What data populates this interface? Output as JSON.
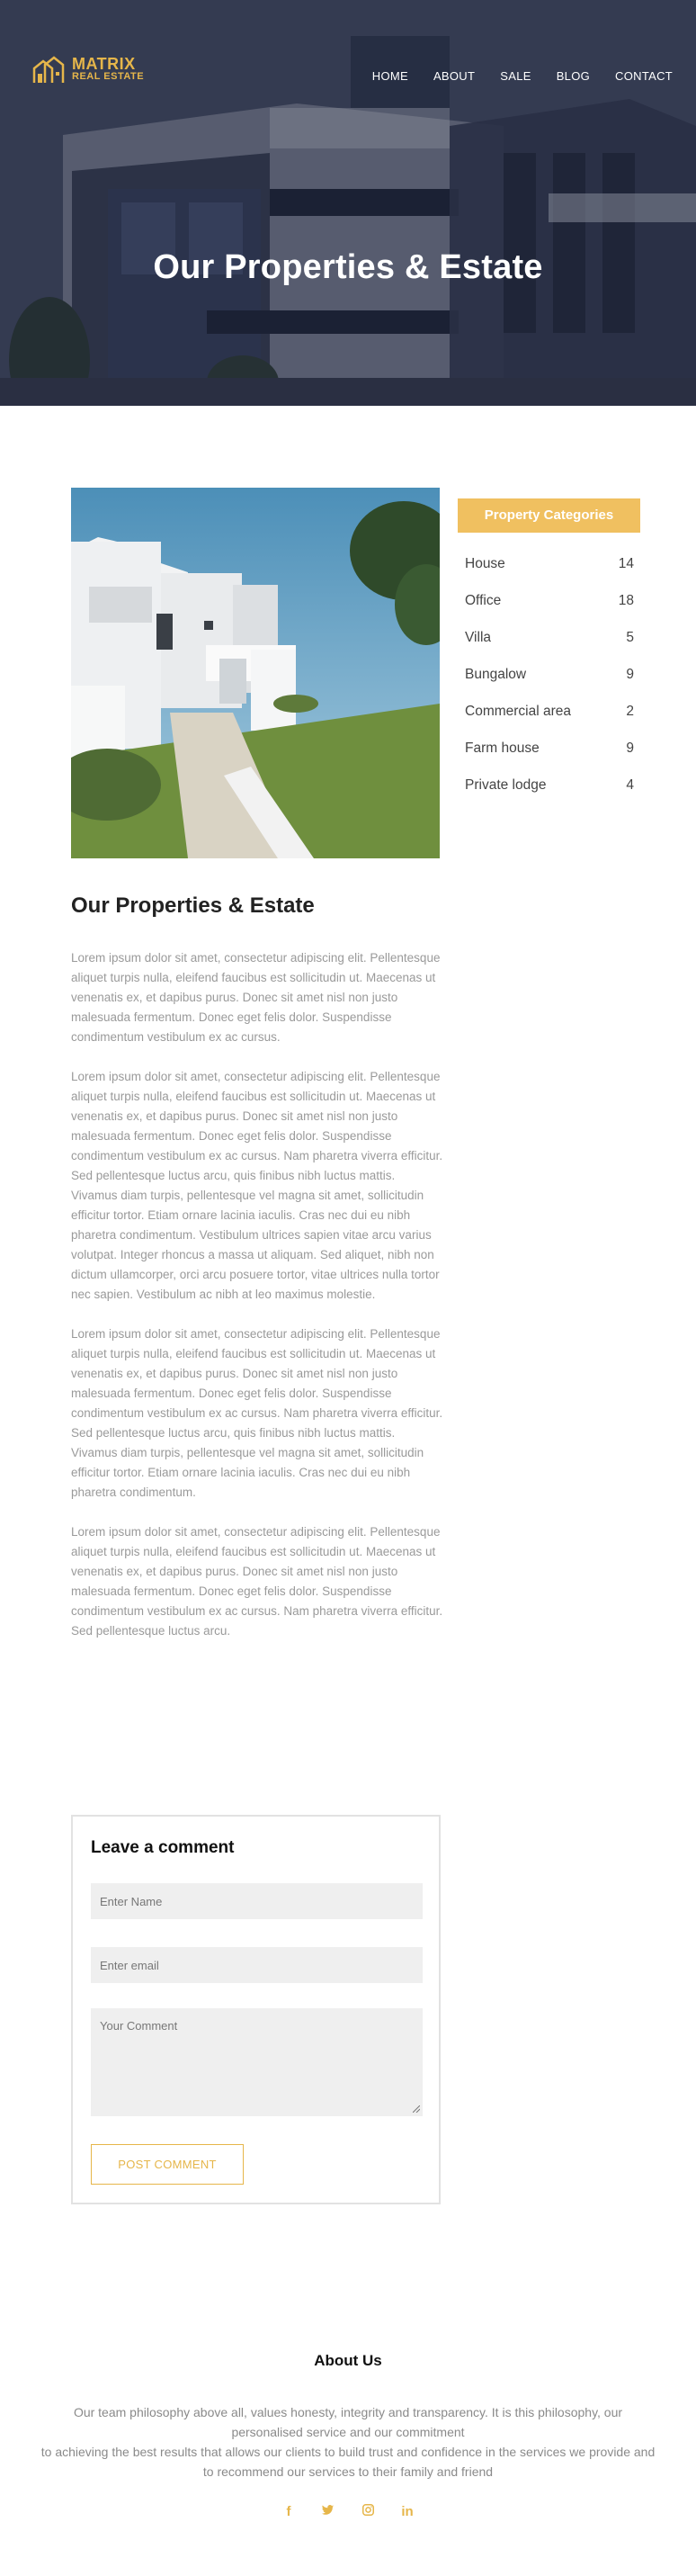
{
  "brand": {
    "name_line1": "MATRIX",
    "name_line2": "REAL ESTATE",
    "color": "#e6b64a"
  },
  "nav": {
    "items": [
      "HOME",
      "ABOUT",
      "SALE",
      "BLOG",
      "CONTACT"
    ]
  },
  "hero": {
    "title": "Our Properties & Estate"
  },
  "article": {
    "title": "Our Properties & Estate",
    "paragraphs": [
      "Lorem ipsum dolor sit amet, consectetur adipiscing elit. Pellentesque aliquet turpis nulla, eleifend faucibus est sollicitudin ut. Maecenas ut venenatis ex, et dapibus purus. Donec sit amet nisl non justo malesuada fermentum. Donec eget felis dolor. Suspendisse condimentum vestibulum ex ac cursus.",
      "Lorem ipsum dolor sit amet, consectetur adipiscing elit. Pellentesque aliquet turpis nulla, eleifend faucibus est sollicitudin ut. Maecenas ut venenatis ex, et dapibus purus. Donec sit amet nisl non justo malesuada fermentum. Donec eget felis dolor. Suspendisse condimentum vestibulum ex ac cursus. Nam pharetra viverra efficitur. Sed pellentesque luctus arcu, quis finibus nibh luctus mattis. Vivamus diam turpis, pellentesque vel magna sit amet, sollicitudin efficitur tortor. Etiam ornare lacinia iaculis. Cras nec dui eu nibh pharetra condimentum. Vestibulum ultrices sapien vitae arcu varius volutpat. Integer rhoncus a massa ut aliquam. Sed aliquet, nibh non dictum ullamcorper, orci arcu posuere tortor, vitae ultrices nulla tortor nec sapien. Vestibulum ac nibh at leo maximus molestie.",
      "Lorem ipsum dolor sit amet, consectetur adipiscing elit. Pellentesque aliquet turpis nulla, eleifend faucibus est sollicitudin ut. Maecenas ut venenatis ex, et dapibus purus. Donec sit amet nisl non justo malesuada fermentum. Donec eget felis dolor. Suspendisse condimentum vestibulum ex ac cursus. Nam pharetra viverra efficitur. Sed pellentesque luctus arcu, quis finibus nibh luctus mattis. Vivamus diam turpis, pellentesque vel magna sit amet, sollicitudin efficitur tortor. Etiam ornare lacinia iaculis. Cras nec dui eu nibh pharetra condimentum.",
      "Lorem ipsum dolor sit amet, consectetur adipiscing elit. Pellentesque aliquet turpis nulla, eleifend faucibus est sollicitudin ut. Maecenas ut venenatis ex, et dapibus purus. Donec sit amet nisl non justo malesuada fermentum. Donec eget felis dolor. Suspendisse condimentum vestibulum ex ac cursus. Nam pharetra viverra efficitur. Sed pellentesque luctus arcu."
    ]
  },
  "sidebar": {
    "heading": "Property Categories",
    "heading_color": "#f0c060",
    "categories": [
      {
        "label": "House",
        "count": "14"
      },
      {
        "label": "Office",
        "count": "18"
      },
      {
        "label": "Villa",
        "count": "5"
      },
      {
        "label": "Bungalow",
        "count": "9"
      },
      {
        "label": "Commercial area",
        "count": "2"
      },
      {
        "label": "Farm house",
        "count": "9"
      },
      {
        "label": "Private lodge",
        "count": "4"
      }
    ]
  },
  "comment_form": {
    "title": "Leave a comment",
    "name_placeholder": "Enter Name",
    "email_placeholder": "Enter email",
    "comment_placeholder": "Your Comment",
    "submit_label": "POST COMMENT"
  },
  "footer": {
    "about_title": "About Us",
    "about_lines": [
      "Our team philosophy above all, values honesty, integrity and transparency. It is this philosophy, our",
      "personalised service and our commitment",
      "to achieving the best results that allows our clients to build trust and confidence in the services we provide and",
      "to recommend our services to their family and friend"
    ],
    "social_icons": [
      "facebook-icon",
      "twitter-icon",
      "instagram-icon",
      "linkedin-icon"
    ]
  }
}
